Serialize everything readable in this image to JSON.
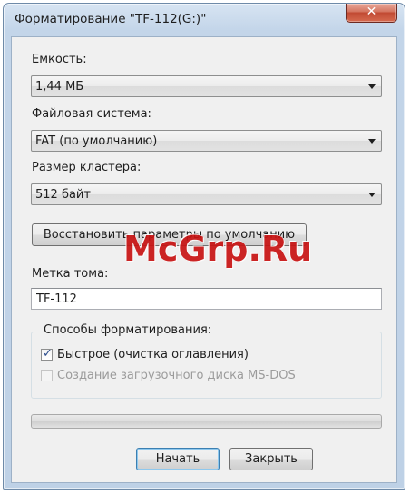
{
  "window": {
    "title": "Форматирование \"TF-112(G:)\"",
    "close_glyph": "✕"
  },
  "capacity": {
    "label": "Емкость:",
    "value": "1,44 МБ"
  },
  "filesystem": {
    "label": "Файловая система:",
    "value": "FAT (по умолчанию)"
  },
  "cluster": {
    "label": "Размер кластера:",
    "value": "512 байт"
  },
  "restore_button": "Восстановить параметры по умолчанию",
  "volume": {
    "label": "Метка тома:",
    "value": "TF-112"
  },
  "format_options": {
    "legend": "Способы форматирования:",
    "quick": {
      "label": "Быстрое (очистка оглавления)",
      "checked": true
    },
    "msdos": {
      "label": "Создание загрузочного диска MS-DOS",
      "checked": false,
      "enabled": false
    }
  },
  "progress": {
    "value": 0
  },
  "buttons": {
    "start": "Начать",
    "close": "Закрыть"
  },
  "watermark": "McGrp.Ru",
  "icons": {
    "close": "close-icon",
    "dropdown": "chevron-down-icon",
    "checkmark": "checkmark-icon"
  },
  "colors": {
    "close_button": "#c14a33",
    "watermark": "#c81313",
    "dialog_bg": "#f0f0f0"
  }
}
